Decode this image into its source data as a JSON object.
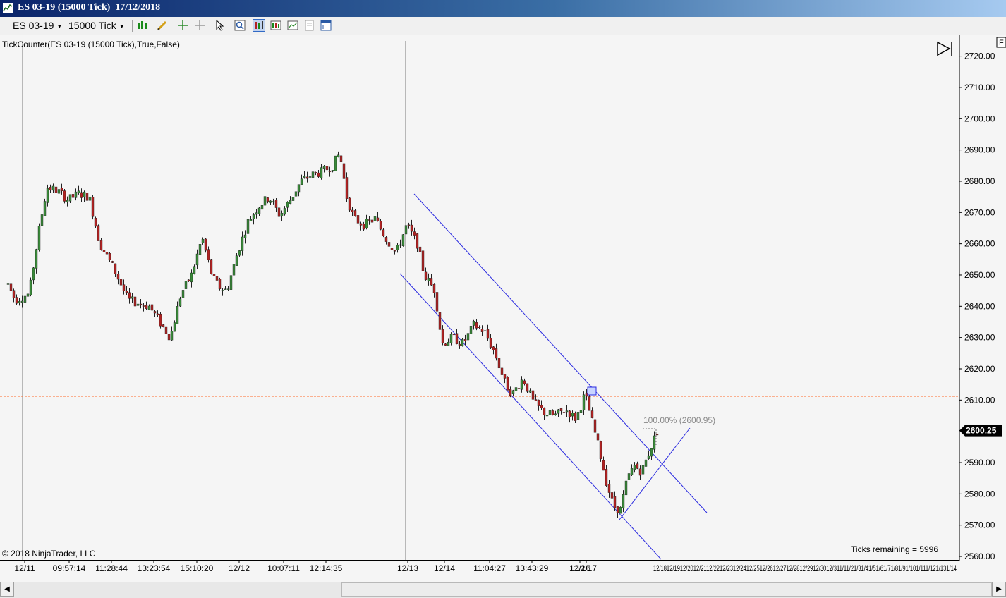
{
  "window": {
    "title": "ES 03-19 (15000 Tick)  17/12/2018"
  },
  "toolbar": {
    "instrument": "ES 03-19",
    "interval": "15000 Tick",
    "icons": [
      "bar-style-icon",
      "drawing-pencil-icon",
      "crosshair-icon",
      "global-crosshair-icon",
      "pointer-icon",
      "zoom-icon",
      "strategy-icon",
      "indicator-icon",
      "chart-properties-icon",
      "templates-icon",
      "data-box-icon"
    ]
  },
  "chart": {
    "indicator_label": "TickCounter(ES  03-19 (15000 Tick),True,False)",
    "copyright": "© 2018 NinjaTrader, LLC",
    "ticks_remaining": "Ticks remaining = 5996",
    "price_badge": "2600.25",
    "fib_label": "100.00% (2600.95)",
    "colors": {
      "up_candle": "#3a8a3a",
      "down_candle": "#b22222",
      "channel": "#2a2ae0",
      "price_line": "#ff6a2a",
      "separator": "#b8b8b8"
    },
    "y_axis_ticks": [
      "2720.00",
      "2710.00",
      "2700.00",
      "2690.00",
      "2680.00",
      "2670.00",
      "2660.00",
      "2650.00",
      "2640.00",
      "2630.00",
      "2620.00",
      "2610.00",
      "2590.00",
      "2580.00",
      "2570.00",
      "2560.00"
    ],
    "x_axis_labels": [
      "12/11",
      "09:57:14",
      "11:28:44",
      "13:23:54",
      "15:10:20",
      "12/12",
      "10:07:11",
      "12:14:35",
      "12/13",
      "12/14",
      "11:04:27",
      "13:43:29",
      "12/16",
      "12/17"
    ],
    "x_axis_future_labels": "12/1812/1912/2012/2112/2212/2312/2412/2512/2612/2712/2812/2912/3012/311/11/21/31/41/51/61/71/81/91/101/111/121/131/14"
  },
  "scrollbar": {
    "left_arrow": "◀",
    "right_arrow": "▶"
  }
}
